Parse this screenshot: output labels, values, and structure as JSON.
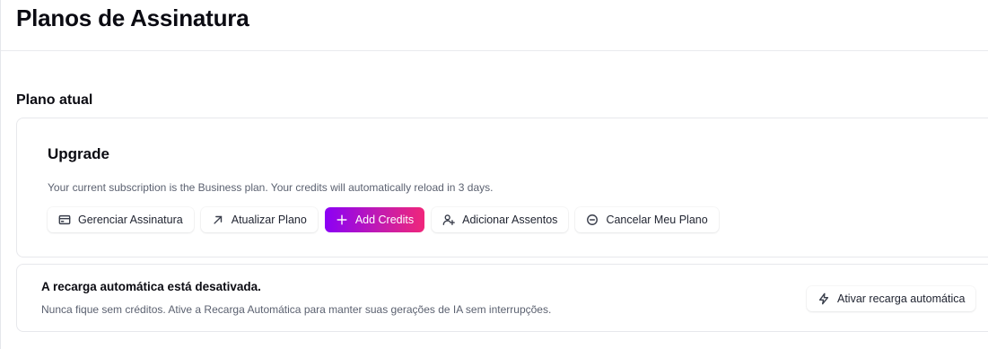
{
  "page": {
    "title": "Planos de Assinatura"
  },
  "current_plan": {
    "section_title": "Plano atual",
    "card_title": "Upgrade",
    "description": "Your current subscription is the Business plan. Your credits will automatically reload in 3 days.",
    "actions": [
      {
        "label": "Gerenciar Assinatura",
        "icon": "credit-card-icon"
      },
      {
        "label": "Atualizar Plano",
        "icon": "arrow-up-right-icon"
      },
      {
        "label": "Add Credits",
        "icon": "plus-icon",
        "primary": true
      },
      {
        "label": "Adicionar Assentos",
        "icon": "user-plus-icon"
      },
      {
        "label": "Cancelar Meu Plano",
        "icon": "circle-minus-icon"
      }
    ]
  },
  "auto_reload": {
    "title": "A recarga automática está desativada.",
    "description": "Nunca fique sem créditos. Ative a Recarga Automática para manter suas gerações de IA sem interrupções.",
    "button_label": "Ativar recarga automática",
    "button_icon": "lightning-icon"
  },
  "colors": {
    "primary_gradient_start": "#8b00f5",
    "primary_gradient_end": "#f0267a",
    "text_muted": "#5b6170",
    "border": "#e7e8ec"
  }
}
